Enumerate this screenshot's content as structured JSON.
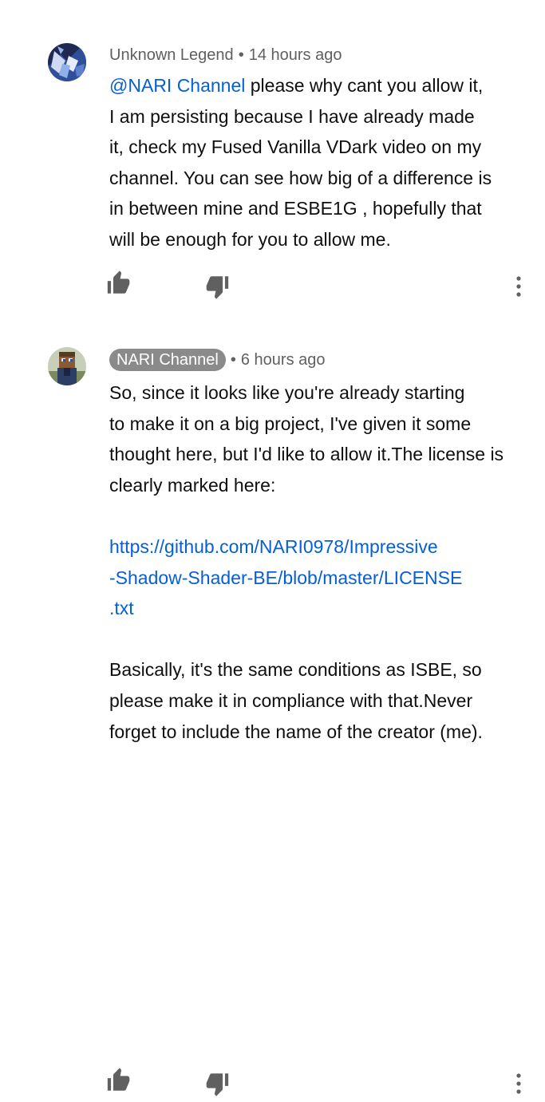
{
  "comments": [
    {
      "author": "Unknown Legend",
      "time": "14 hours ago",
      "is_channel_owner": false,
      "mention": "@NARI Channel",
      "lines": [
        " please why cant you allow it,",
        "I am persisting because I have already made",
        "it, check my Fused Vanilla VDark video on my",
        "channel. You can see how big of a difference is",
        "in between mine and ESBE1G , hopefully that",
        "will be enough for you to allow me."
      ],
      "icons": {
        "like": "thumbs-up-icon",
        "dislike": "thumbs-down-icon",
        "more": "more-vertical-icon"
      }
    },
    {
      "author": "NARI Channel",
      "time": "6 hours ago",
      "is_channel_owner": true,
      "lines": [
        "So, since it looks like you're already starting",
        "to make it on a big project, I've given it some",
        "thought here, but I'd like to allow it.The license is",
        "clearly marked here:"
      ],
      "link_lines": [
        "https://github.com/NARI0978/Impressive",
        "-Shadow-Shader-BE/blob/master/LICENSE",
        ".txt"
      ],
      "lines_after": [
        "Basically, it's the same conditions as ISBE, so",
        "please make it in compliance with that.Never",
        "forget to include the name of the creator (me)."
      ],
      "icons": {
        "like": "thumbs-up-icon",
        "dislike": "thumbs-down-icon",
        "more": "more-vertical-icon"
      }
    }
  ],
  "colors": {
    "text": "#0f0f0f",
    "meta": "#606060",
    "link": "#065fd4",
    "badge": "#8a8a8a",
    "icon": "#606060"
  },
  "separator": "•"
}
